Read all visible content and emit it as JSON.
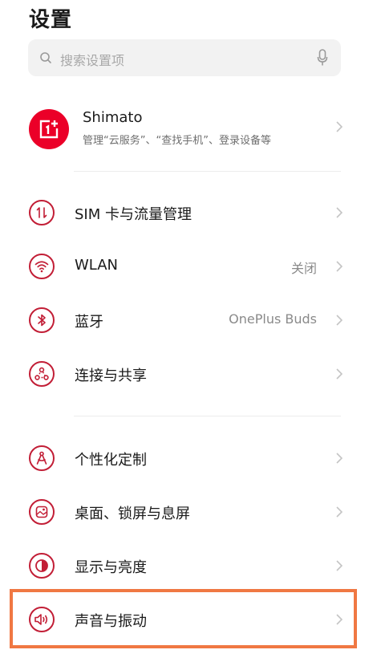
{
  "page": {
    "title": "设置"
  },
  "search": {
    "placeholder": "搜索设置项",
    "icon": "search-icon",
    "mic_icon": "microphone-icon"
  },
  "account": {
    "name": "Shimato",
    "subtitle": "管理“云服务”、“查找手机”、登录设备等",
    "logo_icon": "oneplus-logo",
    "brand_color": "#eb0028"
  },
  "rows": [
    {
      "label": "SIM 卡与流量管理",
      "value": "",
      "icon": "sim-data-icon"
    },
    {
      "label": "WLAN",
      "value": "关闭",
      "icon": "wifi-icon"
    },
    {
      "label": "蓝牙",
      "value": "OnePlus Buds",
      "icon": "bluetooth-icon"
    },
    {
      "label": "连接与共享",
      "value": "",
      "icon": "connection-share-icon"
    },
    {
      "label": "个性化定制",
      "value": "",
      "icon": "personalization-icon"
    },
    {
      "label": "桌面、锁屏与息屏",
      "value": "",
      "icon": "wallpaper-icon"
    },
    {
      "label": "显示与亮度",
      "value": "",
      "icon": "display-brightness-icon"
    },
    {
      "label": "声音与振动",
      "value": "",
      "icon": "sound-vibration-icon"
    }
  ],
  "colors": {
    "accent": "#c21e36",
    "highlight": "#f07843",
    "chevron": "#c4c4c4"
  }
}
